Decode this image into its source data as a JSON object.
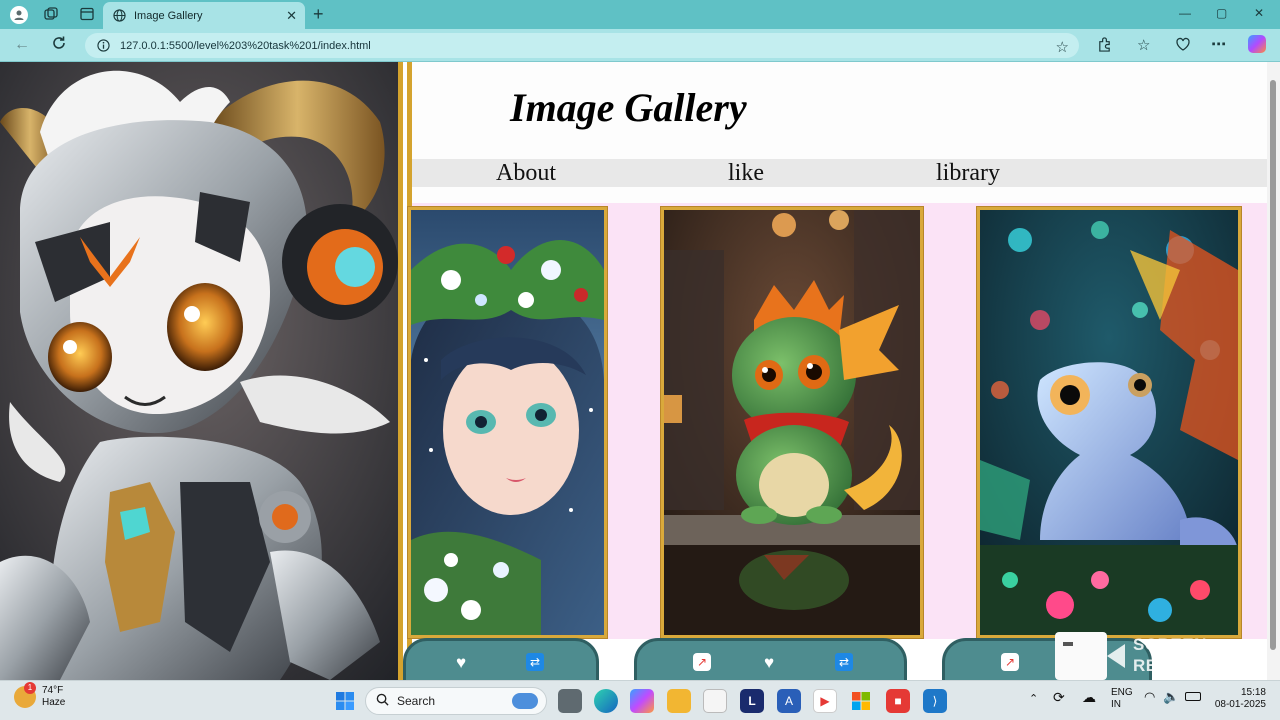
{
  "browser": {
    "tab_title": "Image Gallery",
    "url": "127.0.0.1:5500/level%203%20task%201/index.html"
  },
  "page": {
    "heading": "Image Gallery",
    "nav": [
      "About",
      "like",
      "library"
    ],
    "gallery": [
      {
        "subject": "girl with flower crown"
      },
      {
        "subject": "baby green dragon"
      },
      {
        "subject": "glowing lizard"
      }
    ],
    "icons": {
      "heart": "heart-icon",
      "repeat": "repeat-icon",
      "share": "share-icon"
    }
  },
  "taskbar": {
    "weather_temp": "74°F",
    "weather_desc": "Haze",
    "weather_badge": "1",
    "search_label": "Search",
    "lang_top": "ENG",
    "lang_bottom": "IN",
    "time": "15:18",
    "date": "08-01-2025"
  },
  "overlay": {
    "recorder_line1": "SCREEN",
    "recorder_line2": "RECORDER"
  },
  "colors": {
    "accent_gold": "#d4a32e",
    "gallery_bg": "#fbe3f6",
    "pill": "#4e8c8f",
    "browser_chrome": "#5fc1c5"
  }
}
